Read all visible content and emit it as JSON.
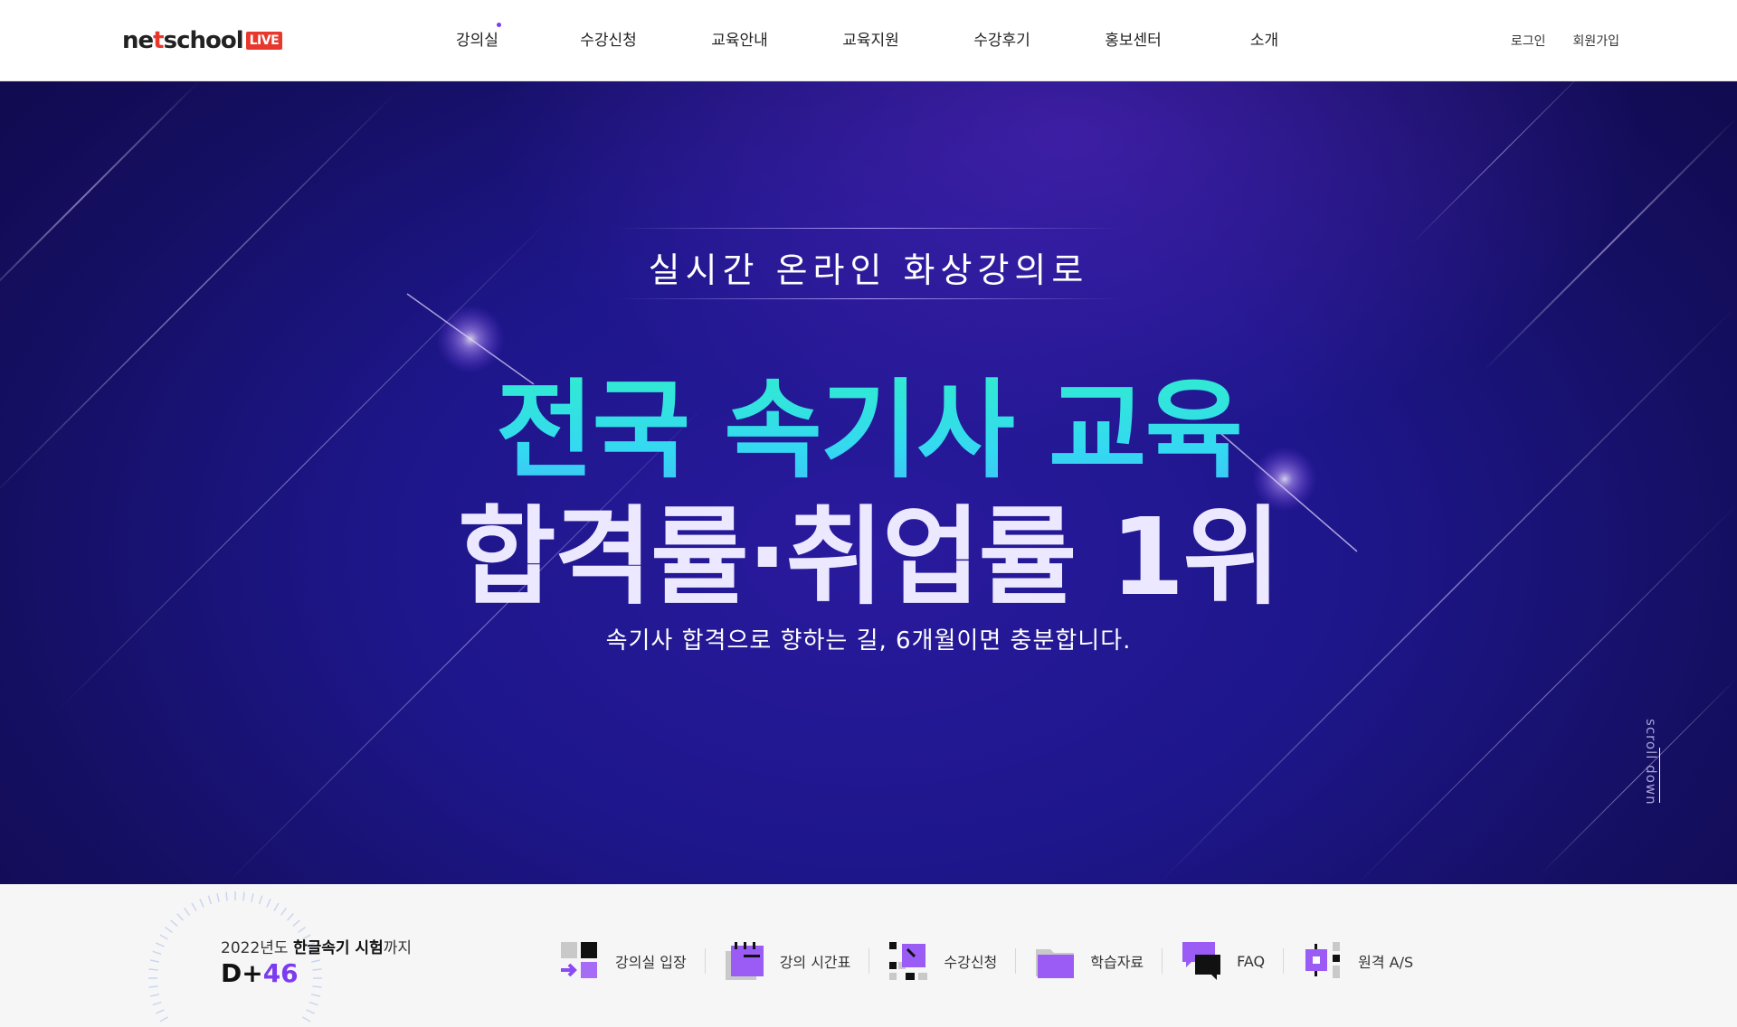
{
  "header": {
    "logo": {
      "prefix": "ne",
      "highlight": "t",
      "suffix": "school",
      "badge": "LIVE"
    },
    "nav": [
      {
        "label": "강의실",
        "active_dot": true
      },
      {
        "label": "수강신청"
      },
      {
        "label": "교육안내"
      },
      {
        "label": "교육지원"
      },
      {
        "label": "수강후기"
      },
      {
        "label": "홍보센터"
      },
      {
        "label": "소개"
      }
    ],
    "util": {
      "login": "로그인",
      "signup": "회원가입"
    }
  },
  "hero": {
    "subtitle": "실시간 온라인 화상강의로",
    "title_line1": "전국 속기사 교육",
    "title_line2": "합격률·취업률 1위",
    "description": "속기사 합격으로 향하는 길, 6개월이면 충분합니다.",
    "scroll": "scroll down"
  },
  "dday": {
    "prefix": "2022년도 ",
    "bold": "한글속기 시험",
    "suffix": "까지",
    "d_label": "D+",
    "d_value": "46"
  },
  "quick_menu": [
    {
      "label": "강의실 입장",
      "icon": "classroom-enter-icon"
    },
    {
      "label": "강의 시간표",
      "icon": "timetable-icon"
    },
    {
      "label": "수강신청",
      "icon": "enroll-icon"
    },
    {
      "label": "학습자료",
      "icon": "folder-icon"
    },
    {
      "label": "FAQ",
      "icon": "chat-icon"
    },
    {
      "label": "원격 A/S",
      "icon": "remote-support-icon"
    }
  ],
  "colors": {
    "accent": "#7b3cf0",
    "brand_red": "#e8382d",
    "hero_bg": "#1d168a",
    "title_cyan": "#2ff2c4"
  }
}
